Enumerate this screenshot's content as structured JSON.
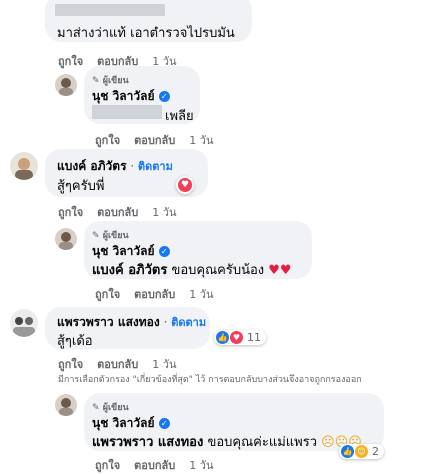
{
  "comments": [
    {
      "text_suffix": "มาส่างว่าแท้ เอาตำรวจไปรบมัน",
      "actions": {
        "like": "ถูกใจ",
        "reply": "ตอบกลับ",
        "time": "1 วัน"
      }
    },
    {
      "author_badge": "ผู้เขียน",
      "name": "นุช วิลาวัลย์",
      "text_suffix": "เพลีย",
      "actions": {
        "like": "ถูกใจ",
        "reply": "ตอบกลับ",
        "time": "1 วัน"
      }
    },
    {
      "name": "แบงค์ อภิวัตร",
      "follow_label": "ติดตาม",
      "text": "สู้ๆครับพี่",
      "actions": {
        "like": "ถูกใจ",
        "reply": "ตอบกลับ",
        "time": "1 วัน"
      }
    },
    {
      "author_badge": "ผู้เขียน",
      "name": "นุช วิลาวัลย์",
      "mention": "แบงค์ อภิวัตร",
      "text": "ขอบคุณครับน้อง",
      "actions": {
        "like": "ถูกใจ",
        "reply": "ตอบกลับ",
        "time": "1 วัน"
      }
    },
    {
      "name": "แพรวพราว แสงทอง",
      "follow_label": "ติดตาม",
      "text": "สู้ๆเด้อ",
      "reaction_count": "11",
      "actions": {
        "like": "ถูกใจ",
        "reply": "ตอบกลับ",
        "time": "1 วัน"
      }
    },
    {
      "author_badge": "ผู้เขียน",
      "name": "นุช วิลาวัลย์",
      "mention": "แพรวพราว แสงทอง",
      "text": "ขอบคุณค่ะแม่แพรว",
      "reaction_count": "2",
      "actions": {
        "like": "ถูกใจ",
        "reply": "ตอบกลับ",
        "time": "1 วัน"
      }
    }
  ],
  "filter_notice": "มีการเลือกตัวกรอง \"เกี่ยวข้องที่สุด\" ไว้ การตอบกลับบางส่วนจึงอาจถูกกรองออก",
  "colors": {
    "accent": "#1877f2",
    "love": "#f33e58",
    "muted": "#65676b",
    "bubble": "#f0f2f5"
  }
}
